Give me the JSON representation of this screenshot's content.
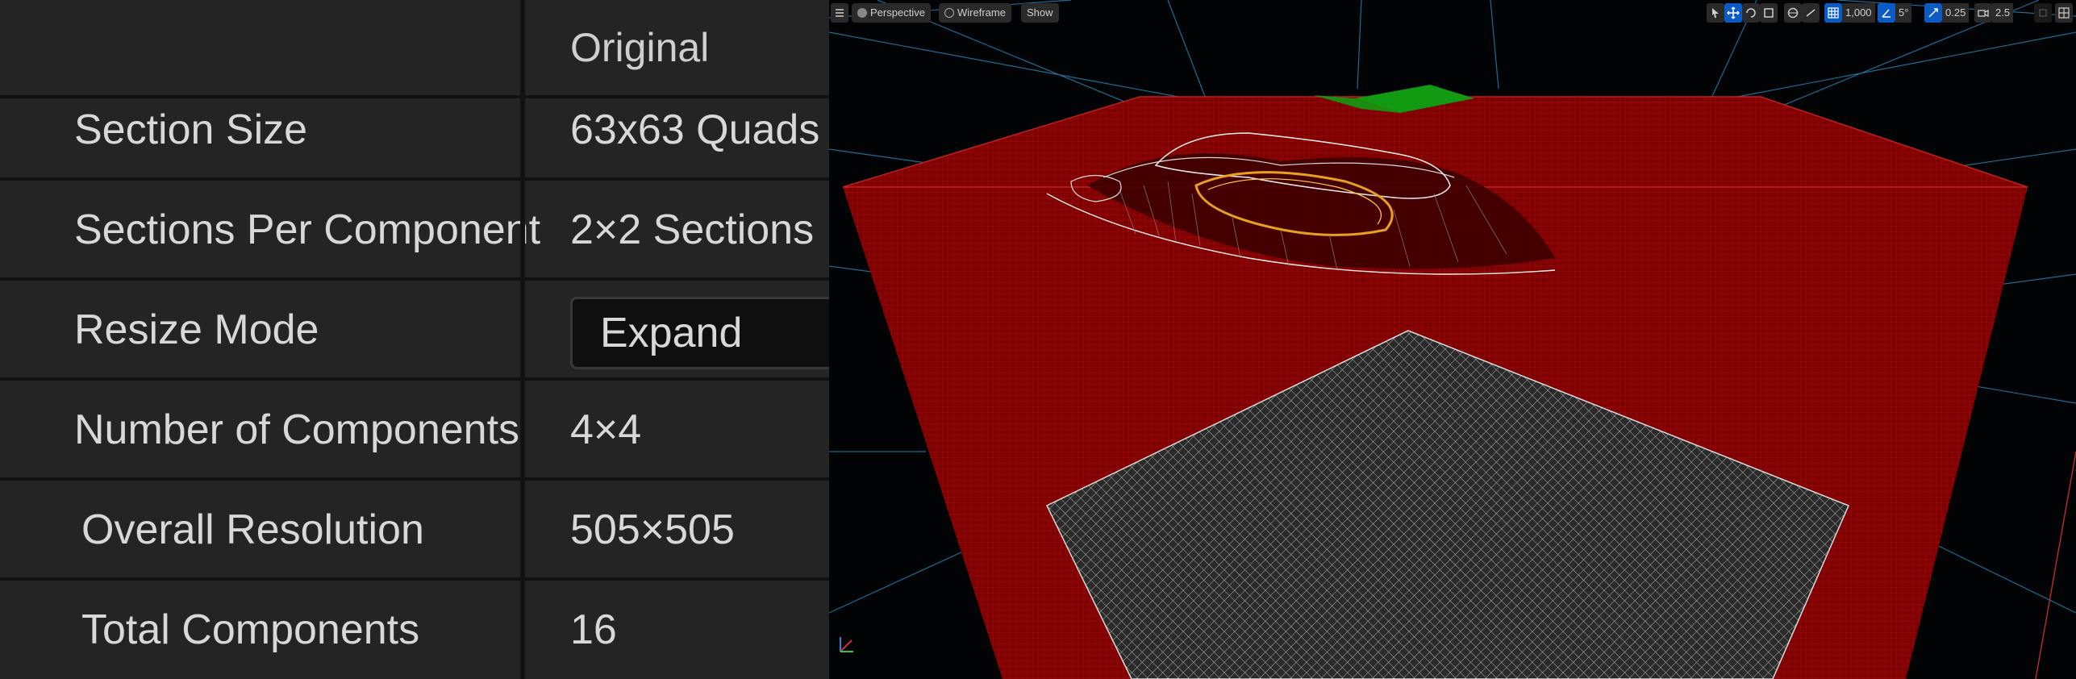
{
  "details": {
    "header": {
      "value": "Original"
    },
    "rows": [
      {
        "label": "Section Size",
        "value": "63x63 Quads"
      },
      {
        "label": "Sections Per Component",
        "value": "2×2 Sections"
      },
      {
        "label": "Resize Mode",
        "value": "Expand"
      },
      {
        "label": "Number of Components",
        "value": "4×4"
      },
      {
        "label": "Overall Resolution",
        "value": "505×505"
      },
      {
        "label": "Total Components",
        "value": "16"
      }
    ]
  },
  "viewport": {
    "menu_icon": "hamburger-icon",
    "view_mode": "Perspective",
    "render_mode": "Wireframe",
    "show_label": "Show",
    "grid_snap": "1,000",
    "rotation_snap": "5°",
    "scale_snap": "0.25",
    "camera_speed": "2.5",
    "colors": {
      "landscape_red": "#8a0000",
      "grid_blue": "#2a8fc4",
      "selection_green": "#129a12",
      "wire_gray": "#a8a8a8",
      "accent_blue": "#0a5cc4"
    }
  }
}
